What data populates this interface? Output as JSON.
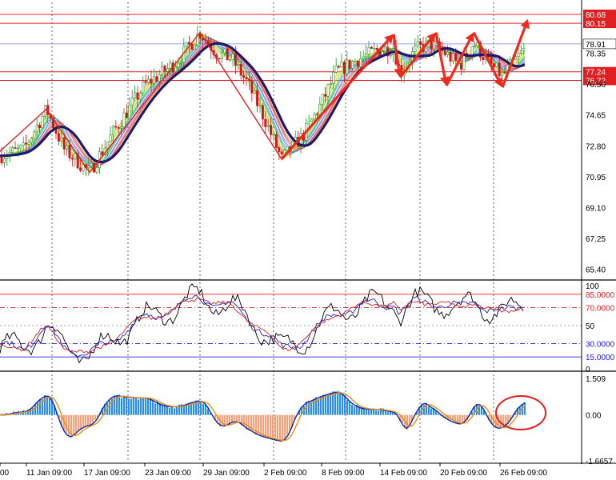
{
  "chart_data": [
    {
      "type": "candlestick",
      "panel": "price",
      "ylim": [
        64.8,
        81.4
      ],
      "y_ticks": [
        "80.68",
        "80.15",
        "78.91",
        "78.35",
        "77.24",
        "76.72",
        "76.50",
        "74.65",
        "72.80",
        "70.95",
        "69.10",
        "67.25",
        "65.40"
      ],
      "horizontal_levels": [
        {
          "value": 80.68,
          "label": "80.68",
          "color": "#e02020"
        },
        {
          "value": 80.15,
          "label": "80.15",
          "color": "#e02020"
        },
        {
          "value": 77.24,
          "label": "77.24",
          "color": "#e02020"
        },
        {
          "value": 76.72,
          "label": "76.72",
          "color": "#e02020"
        },
        {
          "value": 78.91,
          "label": "78.91",
          "color": "#7080ff"
        }
      ],
      "current_price": "78.91",
      "zigzag_pivots": [
        {
          "date": "9 Jan",
          "value": 72.3
        },
        {
          "date": "13 Jan",
          "value": 75.0
        },
        {
          "date": "16 Jan",
          "value": 71.2
        },
        {
          "date": "27 Jan",
          "value": 79.6
        },
        {
          "date": "2 Feb",
          "value": 72.0
        }
      ],
      "forecast_arrows": [
        {
          "from": {
            "date": "2 Feb",
            "value": 72.0
          },
          "to": {
            "date": "14 Feb",
            "value": 79.5
          }
        },
        {
          "from": {
            "date": "14 Feb",
            "value": 79.5
          },
          "to": {
            "date": "15 Feb",
            "value": 76.9
          }
        },
        {
          "from": {
            "date": "15 Feb",
            "value": 76.9
          },
          "to": {
            "date": "19 Feb",
            "value": 79.6
          }
        },
        {
          "from": {
            "date": "19 Feb",
            "value": 79.6
          },
          "to": {
            "date": "20 Feb",
            "value": 76.4
          }
        },
        {
          "from": {
            "date": "20 Feb",
            "value": 76.4
          },
          "to": {
            "date": "23 Feb",
            "value": 79.6
          }
        },
        {
          "from": {
            "date": "23 Feb",
            "value": 79.6
          },
          "to": {
            "date": "25 Feb",
            "value": 76.3
          }
        },
        {
          "from": {
            "date": "25 Feb",
            "value": 76.3
          },
          "to": {
            "date": "28 Feb",
            "value": 80.4
          }
        }
      ],
      "colors": {
        "bull": "#1a9a1a",
        "bear": "#d01818",
        "ma_main": "#1a1a6e"
      }
    },
    {
      "type": "line",
      "panel": "oscillator",
      "ylim": [
        0,
        100
      ],
      "y_ticks": [
        "100",
        "85.0000",
        "70.0000",
        "50",
        "30.0000",
        "15.0000",
        "0"
      ],
      "levels": [
        {
          "value": 85,
          "label": "85.0000",
          "color": "#e02020"
        },
        {
          "value": 70,
          "label": "70.0000",
          "color": "#e02020"
        },
        {
          "value": 50,
          "label": "50",
          "color": "#a0a0a0"
        },
        {
          "value": 30,
          "label": "30.0000",
          "color": "#2020e0"
        },
        {
          "value": 15,
          "label": "15.0000",
          "color": "#2020e0"
        }
      ],
      "colors": {
        "black": "#000000",
        "blue": "#2020d0",
        "red": "#d02020"
      }
    },
    {
      "type": "histogram",
      "panel": "macd",
      "ylim": [
        -1.6657,
        1.509
      ],
      "y_ticks": [
        "1.509",
        "0.00",
        "-1.6657"
      ],
      "colors": {
        "positive": "#2a8ee8",
        "negative": "#f4a07a",
        "signal": "#f08a10",
        "line": "#0a2aa8",
        "highlight": "#e02020"
      }
    }
  ],
  "x_ticks": [
    "00",
    "11 Jan 09:00",
    "17 Jan 09:00",
    "23 Jan 09:00",
    "29 Jan 09:00",
    "2 Feb 09:00",
    "8 Feb 09:00",
    "14 Feb 09:00",
    "20 Feb 09:00",
    "26 Feb 09:00"
  ]
}
